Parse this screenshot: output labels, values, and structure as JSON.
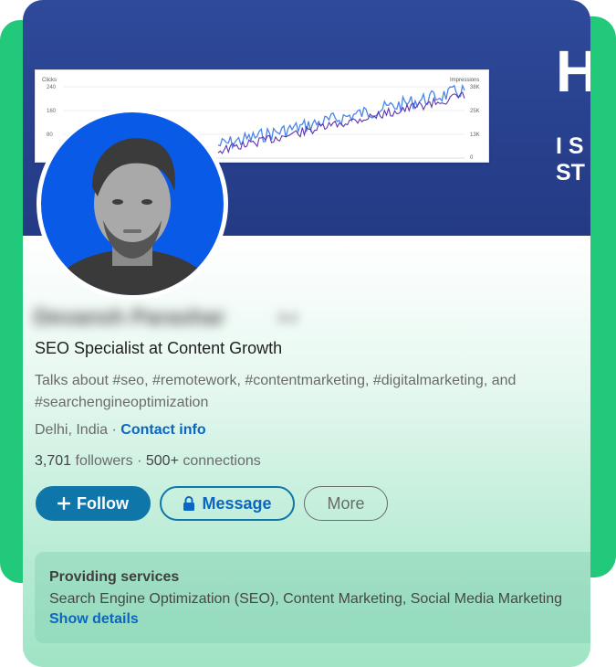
{
  "banner": {
    "graph": {
      "left_axis_title": "Clicks",
      "right_axis_title": "Impressions",
      "left_ticks": [
        "240",
        "160",
        "80"
      ],
      "right_ticks": [
        "38K",
        "25K",
        "13K",
        "0"
      ]
    },
    "headline": "H",
    "subline": "I S\nST"
  },
  "profile": {
    "name": "Devansh Parashar",
    "degree": "3rd",
    "headline": "SEO Specialist at Content Growth",
    "about": "Talks about #seo, #remotework, #contentmarketing, #digitalmarketing, and #searchengineoptimization",
    "location": "Delhi, India",
    "separator": "·",
    "contact_label": "Contact info",
    "followers": "3,701",
    "followers_label": "followers",
    "connections": "500+",
    "connections_label": "connections"
  },
  "actions": {
    "follow_label": "Follow",
    "message_label": "Message",
    "more_label": "More"
  },
  "services": {
    "title": "Providing services",
    "list": "Search Engine Optimization (SEO), Content Marketing, Social Media Marketing",
    "link_label": "Show details"
  },
  "colors": {
    "accent_green": "#22c97b",
    "banner_blue": "#2e4a9a",
    "avatar_bg": "#0a5ae8",
    "link_blue": "#0a66c2",
    "button_blue": "#0e76a8"
  }
}
